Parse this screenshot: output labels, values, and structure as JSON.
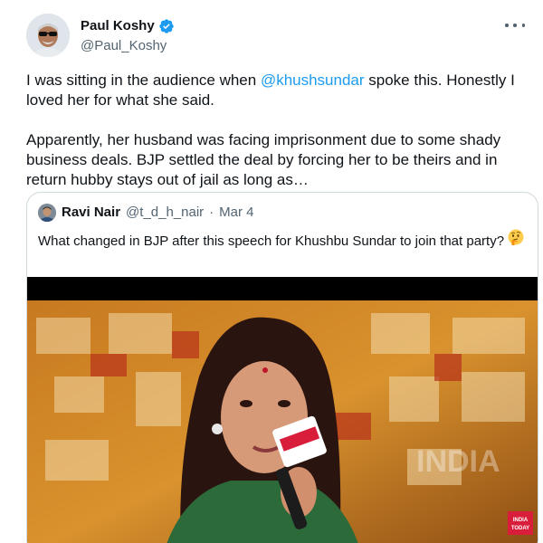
{
  "author": {
    "display_name": "Paul Koshy",
    "handle": "@Paul_Koshy",
    "verified": true,
    "avatar_icon": "avatar-man-sunglasses"
  },
  "menu_icon": "more-dots-icon",
  "tweet": {
    "p1_before": "I was sitting in the audience when ",
    "p1_mention": "@khushsundar",
    "p1_after": " spoke this. Honestly I loved her for what she said.",
    "p2": "Apparently, her husband was facing imprisonment due to some shady business deals. BJP settled the deal by forcing her to be theirs and in return hubby stays out of jail as long as…"
  },
  "quote": {
    "display_name": "Ravi Nair",
    "handle": "@t_d_h_nair",
    "separator": "·",
    "date": "Mar 4",
    "text": "What changed in BJP after this speech for Khushbu Sundar to join that party?",
    "emoji_icon": "thinking-face-emoji",
    "media": {
      "watermark": "INDIA",
      "logo_text_1": "INDIA",
      "logo_text_2": "TODAY"
    }
  },
  "colors": {
    "link": "#1d9bf0",
    "secondary_text": "#536471",
    "border": "#cfd9de"
  }
}
